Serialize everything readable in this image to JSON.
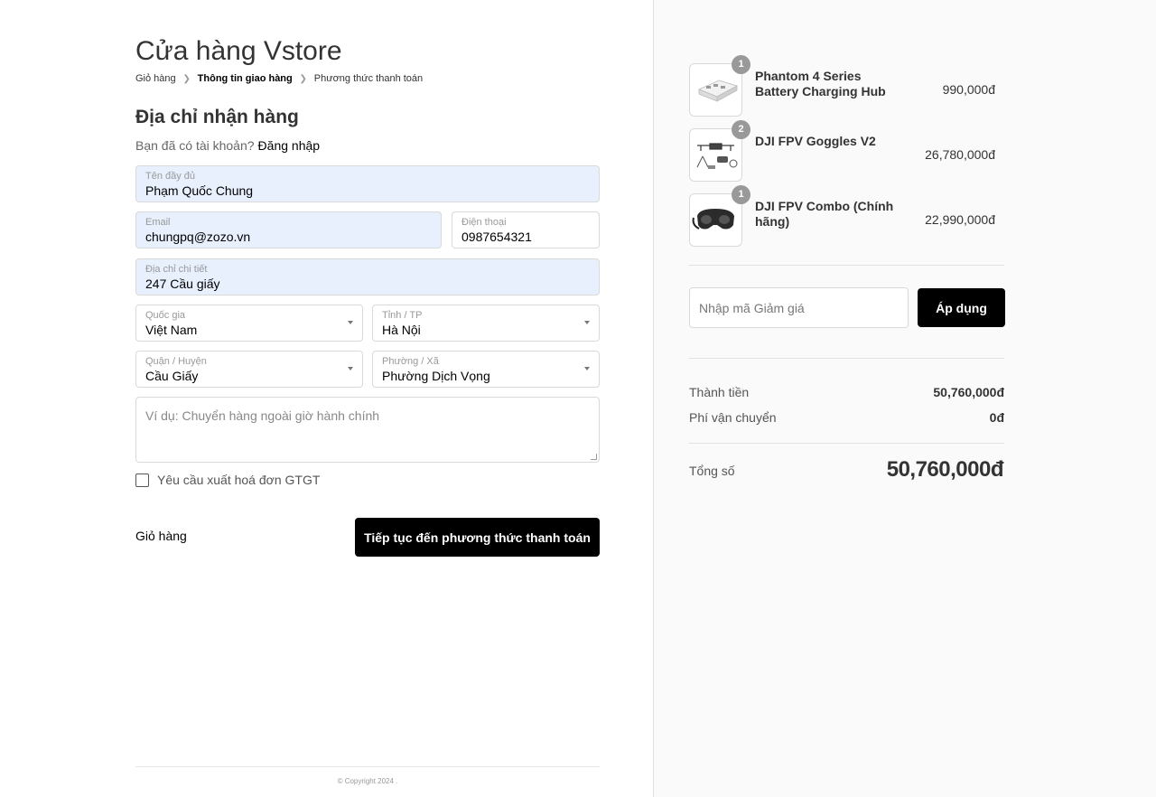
{
  "store": {
    "title": "Cửa hàng Vstore"
  },
  "breadcrumb": {
    "items": [
      "Giỏ hàng",
      "Thông tin giao hàng",
      "Phương thức thanh toán"
    ]
  },
  "shipping": {
    "title": "Địa chỉ nhận hàng",
    "have_account": "Bạn đã có tài khoản?",
    "login_link": "Đăng nhập",
    "fullname": {
      "label": "Tên đầy đủ",
      "value": "Phạm Quốc Chung"
    },
    "email": {
      "label": "Email",
      "value": "chungpq@zozo.vn"
    },
    "phone": {
      "label": "Điện thoại",
      "value": "0987654321"
    },
    "address": {
      "label": "Địa chỉ chi tiết",
      "value": "247 Cầu giấy"
    },
    "country": {
      "label": "Quốc gia",
      "value": "Việt Nam"
    },
    "province": {
      "label": "Tỉnh / TP",
      "value": "Hà Nội"
    },
    "district": {
      "label": "Quận / Huyện",
      "value": "Cầu Giấy"
    },
    "ward": {
      "label": "Phường / Xã",
      "value": "Phường Dịch Vọng"
    },
    "note": {
      "placeholder": "Ví dụ: Chuyển hàng ngoài giờ hành chính"
    },
    "vat_checkbox": "Yêu cầu xuất hoá đơn GTGT",
    "back_link": "Giỏ hàng",
    "continue_button": "Tiếp tục đến phương thức thanh toán"
  },
  "footer": {
    "copyright": "© Copyright 2024 ."
  },
  "cart": {
    "items": [
      {
        "qty": "1",
        "name": "Phantom 4 Series Battery Charging Hub",
        "price": "990,000đ",
        "icon": "battery-hub-image"
      },
      {
        "qty": "2",
        "name": "DJI FPV Goggles V2",
        "price": "26,780,000đ",
        "icon": "drone-kit-image"
      },
      {
        "qty": "1",
        "name": "DJI FPV Combo (Chính hãng)",
        "price": "22,990,000đ",
        "icon": "goggles-image"
      }
    ],
    "discount_placeholder": "Nhập mã Giảm giá",
    "apply_button": "Áp dụng",
    "subtotal_label": "Thành tiền",
    "subtotal_value": "50,760,000đ",
    "shipping_label": "Phí vận chuyển",
    "shipping_value": "0đ",
    "total_label": "Tổng số",
    "total_value": "50,760,000đ"
  }
}
